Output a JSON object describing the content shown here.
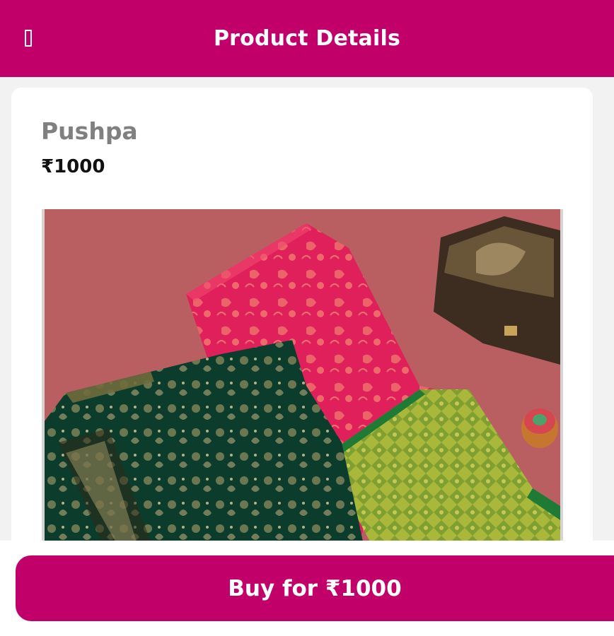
{
  "app_bar": {
    "title": "Product Details",
    "back_icon": "back-icon",
    "background": "#c2006a"
  },
  "product": {
    "name": "Pushpa",
    "price": "₹1000",
    "image_alt": "Saree with green embroidered blouse"
  },
  "actions": {
    "buy_label": "Buy for ₹1000",
    "accent": "#c2006a"
  }
}
